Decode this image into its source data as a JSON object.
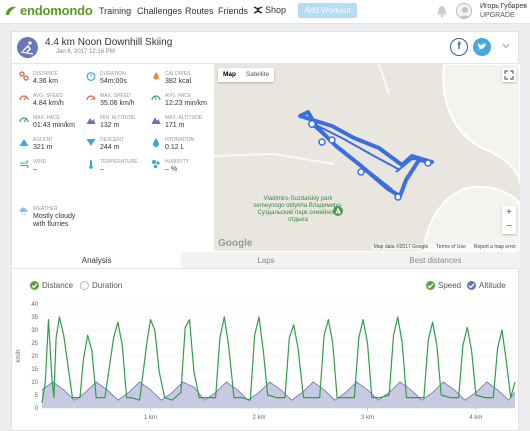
{
  "nav": {
    "brand": "endomondo",
    "links": [
      "Training",
      "Challenges",
      "Routes",
      "Friends"
    ],
    "shop": "Shop",
    "add_workout": "Add Workout",
    "user_name": "Игорь Губарев",
    "upgrade": "UPGRADE"
  },
  "workout": {
    "title": "4.4 km Noon Downhill Skiing",
    "date": "Jan 6, 2017 12:16 PM",
    "fb_label": "f"
  },
  "stats": {
    "distance": {
      "label": "Distance",
      "value": "4.36 km"
    },
    "duration": {
      "label": "Duration",
      "value": "54m:00s"
    },
    "calories": {
      "label": "Calories",
      "value": "382 kcal"
    },
    "avg_speed": {
      "label": "Avg. Speed",
      "value": "4.84 km/h"
    },
    "max_speed": {
      "label": "Max. Speed",
      "value": "35.06 km/h"
    },
    "avg_pace": {
      "label": "Avg. Pace",
      "value": "12:23 min/km"
    },
    "max_pace": {
      "label": "Max. Pace",
      "value": "01:43 min/km"
    },
    "min_altitude": {
      "label": "Min. Altitude",
      "value": "132 m"
    },
    "max_altitude": {
      "label": "Max. Altitude",
      "value": "171 m"
    },
    "ascent": {
      "label": "Ascent",
      "value": "321 m"
    },
    "descent": {
      "label": "Descent",
      "value": "244 m"
    },
    "hydration": {
      "label": "Hydration",
      "value": "0.12 L"
    },
    "wind": {
      "label": "Wind",
      "value": "–"
    },
    "temperature": {
      "label": "Temperature",
      "value": "–"
    },
    "humidity": {
      "label": "Humidity",
      "value": "– %"
    },
    "weather": {
      "label": "Weather",
      "value": "Mostly cloudy with flurries"
    }
  },
  "map": {
    "tab_map": "Map",
    "tab_satellite": "Satellite",
    "poi_name": "Vladimiro-Suzdalskiy park semeynogo otdykha Владимиро-Суздальский парк семейного отдыха",
    "zoom_in": "+",
    "zoom_out": "−",
    "attribution": [
      "Map data ©2017 Google",
      "Terms of Use",
      "Report a map error"
    ],
    "google": "Google"
  },
  "tabs": [
    "Analysis",
    "Laps",
    "Best distances"
  ],
  "legend": {
    "distance": "Distance",
    "duration": "Duration",
    "speed": "Speed",
    "altitude": "Altitude"
  },
  "colors": {
    "brand_green": "#5a9a1c",
    "speed_line": "#2f9e4a",
    "altitude_fill": "#c7cae0",
    "altitude_line": "#6a74b3",
    "route": "#3b6fe0"
  },
  "chart_data": {
    "type": "line",
    "xlabel": "",
    "ylabel": "km/h",
    "ylim": [
      0,
      40
    ],
    "yticks": [
      0,
      5,
      10,
      15,
      20,
      25,
      30,
      35,
      40
    ],
    "xlim": [
      0,
      4.36
    ],
    "xtick_labels": [
      "1 km",
      "2 km",
      "3 km",
      "4 km"
    ],
    "xtick_values": [
      1,
      2,
      3,
      4
    ],
    "series": [
      {
        "name": "Speed",
        "x": [
          0,
          0.03,
          0.06,
          0.09,
          0.11,
          0.13,
          0.16,
          0.2,
          0.28,
          0.35,
          0.38,
          0.42,
          0.46,
          0.5,
          0.58,
          0.66,
          0.7,
          0.74,
          0.78,
          0.82,
          0.9,
          0.97,
          1.0,
          1.04,
          1.08,
          1.13,
          1.2,
          1.28,
          1.32,
          1.36,
          1.4,
          1.45,
          1.52,
          1.6,
          1.64,
          1.68,
          1.72,
          1.77,
          1.84,
          1.92,
          1.96,
          2.0,
          2.04,
          2.08,
          2.16,
          2.24,
          2.28,
          2.32,
          2.36,
          2.41,
          2.48,
          2.56,
          2.6,
          2.64,
          2.68,
          2.72,
          2.8,
          2.88,
          2.92,
          2.96,
          3.0,
          3.04,
          3.12,
          3.2,
          3.24,
          3.28,
          3.32,
          3.36,
          3.44,
          3.52,
          3.56,
          3.6,
          3.64,
          3.68,
          3.76,
          3.84,
          3.88,
          3.92,
          3.96,
          4.0,
          4.08,
          4.16,
          4.2,
          4.24,
          4.28,
          4.32,
          4.36
        ],
        "values": [
          2,
          10,
          34,
          12,
          4,
          27,
          35,
          28,
          4,
          4,
          18,
          28,
          22,
          4,
          4,
          27,
          33,
          24,
          4,
          4,
          3,
          26,
          34,
          30,
          14,
          4,
          3,
          6,
          31,
          34,
          14,
          4,
          4,
          4,
          27,
          35,
          24,
          4,
          4,
          3,
          28,
          35,
          22,
          5,
          4,
          4,
          27,
          32,
          23,
          4,
          4,
          4,
          28,
          34,
          25,
          4,
          4,
          4,
          27,
          34,
          25,
          4,
          4,
          5,
          28,
          35,
          25,
          4,
          4,
          4,
          26,
          33,
          24,
          5,
          4,
          4,
          24,
          31,
          22,
          5,
          4,
          4,
          23,
          30,
          18,
          4,
          10
        ]
      },
      {
        "name": "Altitude",
        "x": [
          0,
          0.1,
          0.2,
          0.3,
          0.4,
          0.5,
          0.6,
          0.7,
          0.8,
          0.9,
          1.0,
          1.1,
          1.2,
          1.3,
          1.4,
          1.5,
          1.6,
          1.7,
          1.8,
          1.9,
          2.0,
          2.1,
          2.2,
          2.3,
          2.4,
          2.5,
          2.6,
          2.7,
          2.8,
          2.9,
          3.0,
          3.1,
          3.2,
          3.3,
          3.4,
          3.5,
          3.6,
          3.7,
          3.8,
          3.9,
          4.0,
          4.1,
          4.2,
          4.3,
          4.36
        ],
        "values": [
          7,
          10,
          7,
          3,
          6,
          10,
          7,
          3,
          6,
          10,
          7,
          3,
          6,
          10,
          8,
          3,
          6,
          10,
          7,
          3,
          6,
          10,
          7,
          3,
          6,
          10,
          7,
          3,
          6,
          10,
          7,
          3,
          6,
          10,
          7,
          3,
          6,
          10,
          7,
          3,
          6,
          10,
          7,
          3,
          6
        ]
      }
    ]
  }
}
